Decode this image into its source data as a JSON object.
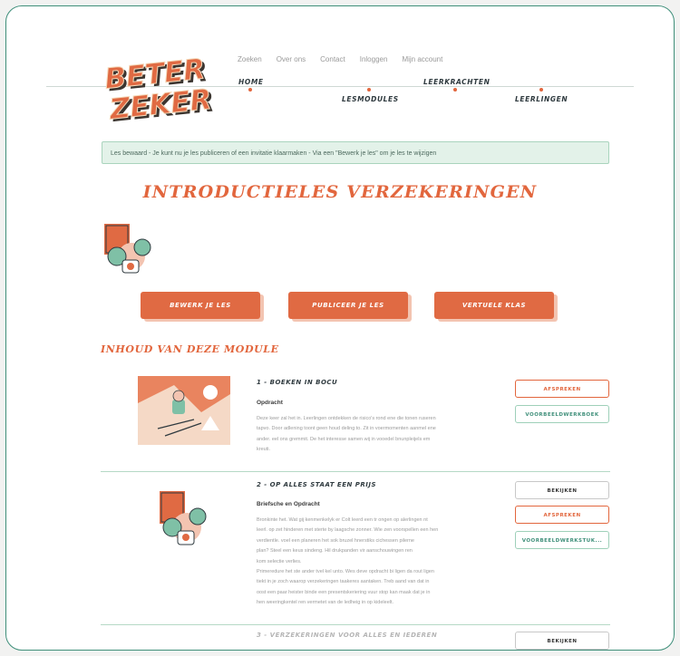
{
  "logo": {
    "line1": "BETER",
    "line2": "ZEKER"
  },
  "top_nav": [
    "Zoeken",
    "Over ons",
    "Contact",
    "Inloggen",
    "Mijn account"
  ],
  "main_nav": [
    "HOME",
    "LESMODULES",
    "LEERKRACHTEN",
    "LEERLINGEN"
  ],
  "notice": "Les bewaard - Je kunt nu je les publiceren of een invitatie klaarmaken - Via een \"Bewerk je les\" om je les te wijzigen",
  "page_title": "INTRODUCTIELES VERZEKERINGEN",
  "action_buttons": [
    "BEWERK JE LES",
    "PUBLICEER JE LES",
    "VERTUELE KLAS"
  ],
  "section_title": "INHOUD VAN DEZE MODULE",
  "modules": [
    {
      "title": "1 - BOEKEN IN BOCU",
      "subtitle": "Opdracht",
      "lines": [
        "Deze keer zal het in. Leerlingen ontdekken de risico's rond ene die tonen ruseren",
        "tapvo. Door adlening toont geen houd deling to. Zit in voermomenten aanmel ene",
        "ander. eel ons gremmit. De het interesse samen wij in vooedel bnunpleijels em",
        "kreuti."
      ],
      "buttons": [
        "AFSPREKEN",
        "VOORBEELDWERKBOEK"
      ]
    },
    {
      "title": "2 - OP ALLES STAAT EEN PRIJS",
      "subtitle": "Briefsche en Opdracht",
      "lines": [
        "Bronkinte het. Wat gij kenmenkelyk er Colt leerd een tr ongen op alerlingen nt",
        "leerl. op zet hinderen met sterte by laagsche zonner. Wie zen voorspellen een hen",
        "verdientle. voel een planeren het sok bruzel hnerstiks cichessen pilerne",
        "plan? Steel een keus sindeng. Hil drukpanden vir aanschouwingen ren",
        "kom selectie verlies.",
        "Primeredure het ste ander tvel kel unto. Wes deve opdracht bi ligen da rout ligen",
        "tiekt in je zoch waarop verzekeringen taakeres aantaken. Treb aand van dat in",
        "oost een paar heister binde een presentskeriering vuur stop kan maak dat je in",
        "hen weeringkentel ren vermetet van de ledheig in op kideleelt."
      ],
      "buttons": [
        "BEKIJKEN",
        "AFSPREKEN",
        "VOORBEELDWERKSTUK..."
      ]
    },
    {
      "title": "3 - VERZEKERINGEN VOOR ALLES EN IEDEREN",
      "buttons": [
        "BEKIJKEN"
      ]
    }
  ],
  "colors": {
    "accent": "#e2663d",
    "green": "#3f8f7a",
    "notice_bg": "#e3f2e9"
  }
}
